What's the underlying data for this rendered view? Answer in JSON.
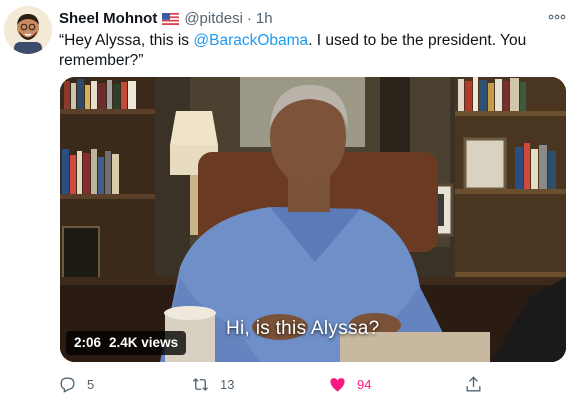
{
  "tweet": {
    "author_name": "Sheel Mohnot",
    "author_flag": "us-flag-icon",
    "handle": "@pitdesi",
    "separator": "·",
    "time": "1h",
    "text_part1": "“Hey Alyssa, this is ",
    "mention": "@BarackObama",
    "text_part2": ". I used to be the president. You remember?”"
  },
  "media": {
    "duration": "2:06",
    "views": "2.4K views",
    "caption": "Hi, is this Alyssa?"
  },
  "actions": {
    "reply_count": "5",
    "retweet_count": "13",
    "like_count": "94"
  },
  "colors": {
    "link": "#1d9bf0",
    "like": "#f91880",
    "muted": "#536471"
  }
}
